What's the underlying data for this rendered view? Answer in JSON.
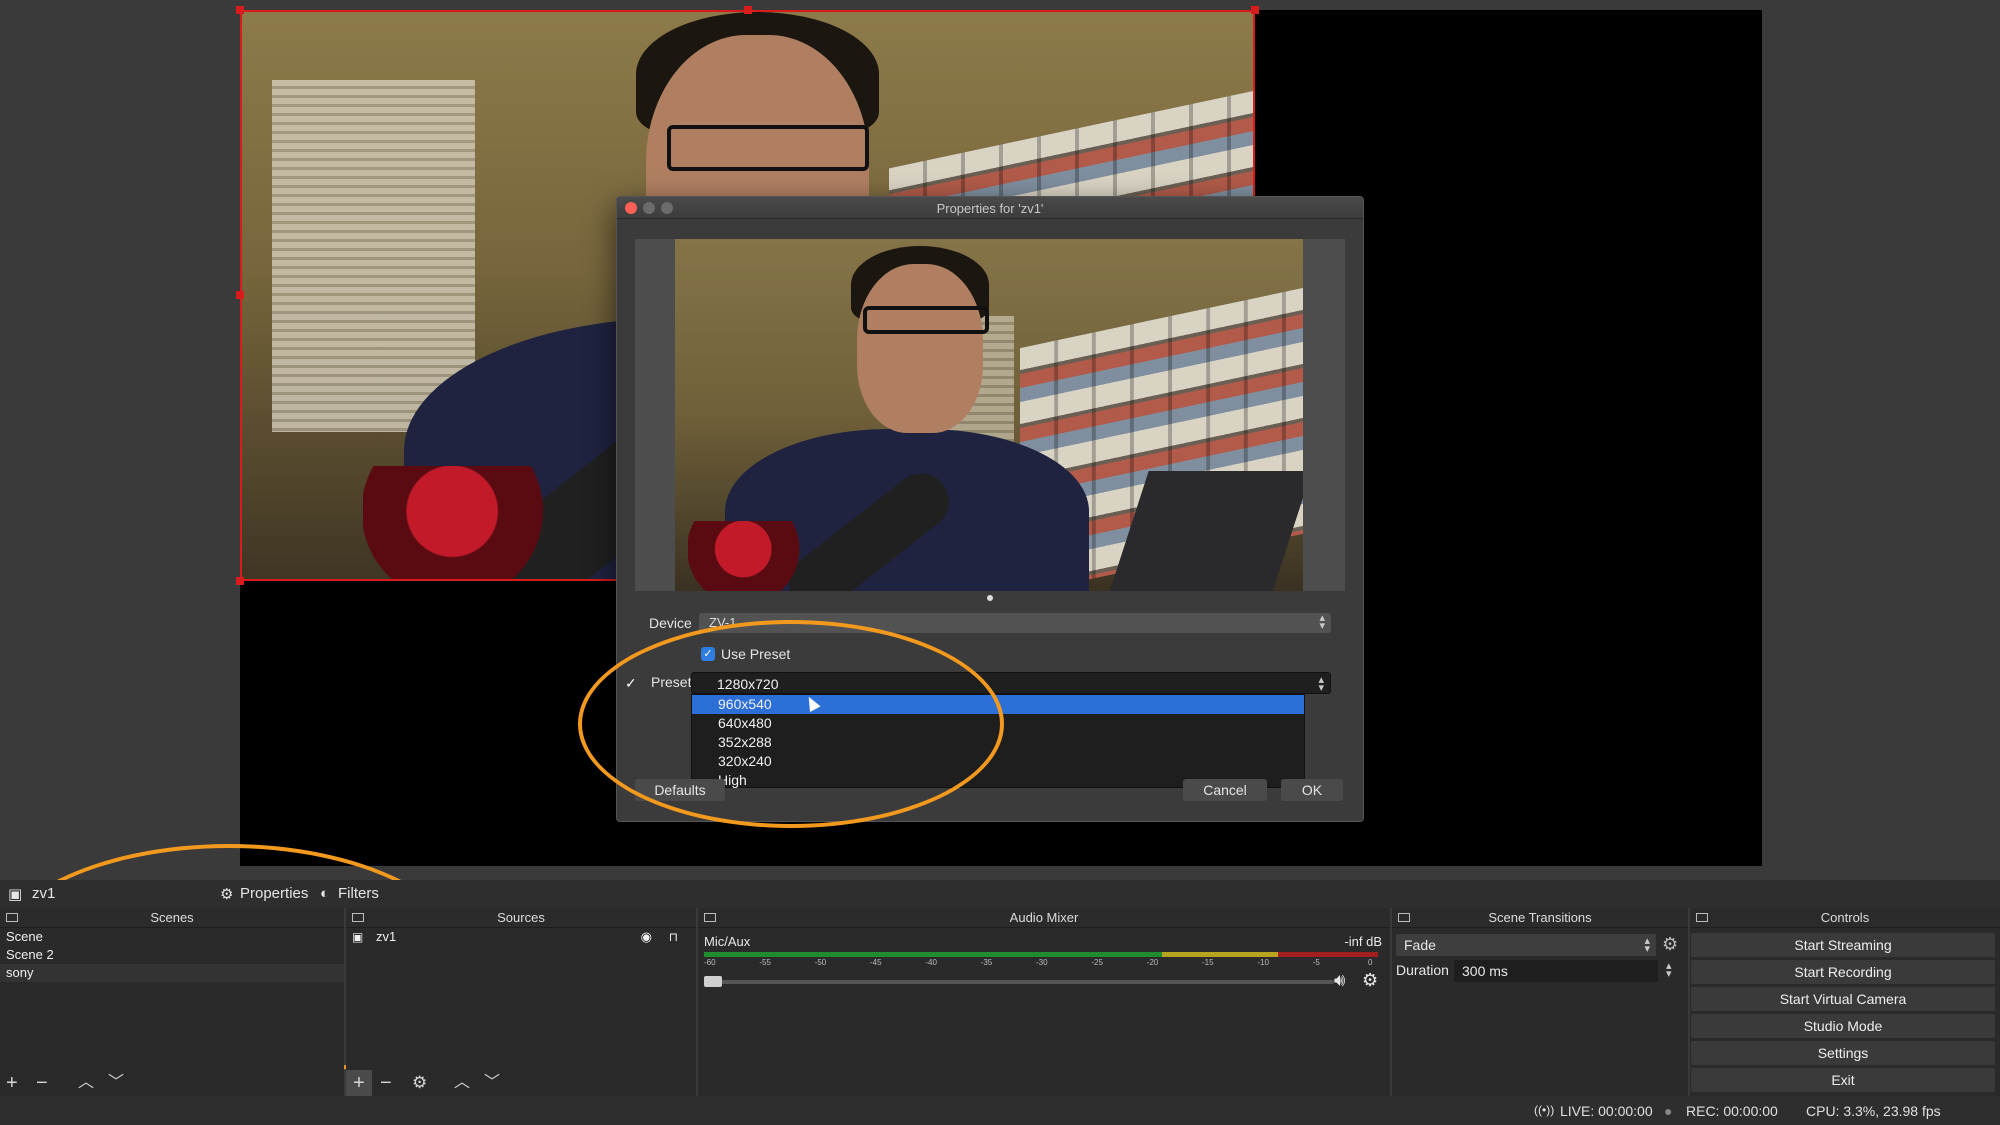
{
  "dialog": {
    "title": "Properties for 'zv1'",
    "device_label": "Device",
    "device_value": "ZV-1",
    "use_preset_label": "Use Preset",
    "use_preset_checked": true,
    "preset_label": "Preset",
    "preset_options": [
      "1280x720",
      "960x540",
      "640x480",
      "352x288",
      "320x240",
      "High"
    ],
    "preset_current": "1280x720",
    "preset_hover": "960x540",
    "defaults_label": "Defaults",
    "cancel_label": "Cancel",
    "ok_label": "OK"
  },
  "toolbar": {
    "source_name": "zv1",
    "properties_label": "Properties",
    "filters_label": "Filters"
  },
  "scenes": {
    "title": "Scenes",
    "items": [
      "Scene",
      "Scene 2",
      "sony"
    ],
    "selected": "sony"
  },
  "sources": {
    "title": "Sources",
    "items": [
      "zv1"
    ]
  },
  "audio_mixer": {
    "title": "Audio Mixer",
    "channel_name": "Mic/Aux",
    "level": "-inf dB",
    "scale": [
      "-60",
      "-55",
      "-50",
      "-45",
      "-40",
      "-35",
      "-30",
      "-25",
      "-20",
      "-15",
      "-10",
      "-5",
      "0"
    ]
  },
  "scene_transitions": {
    "title": "Scene Transitions",
    "transition": "Fade",
    "duration_label": "Duration",
    "duration_value": "300 ms"
  },
  "controls": {
    "title": "Controls",
    "buttons": [
      "Start Streaming",
      "Start Recording",
      "Start Virtual Camera",
      "Studio Mode",
      "Settings",
      "Exit"
    ]
  },
  "status": {
    "live": "LIVE: 00:00:00",
    "rec": "REC: 00:00:00",
    "cpu": "CPU: 3.3%, 23.98 fps"
  },
  "colors": {
    "selection_border": "#d81b1b",
    "annotation": "#f39a1e",
    "highlight": "#2c6fd6"
  }
}
